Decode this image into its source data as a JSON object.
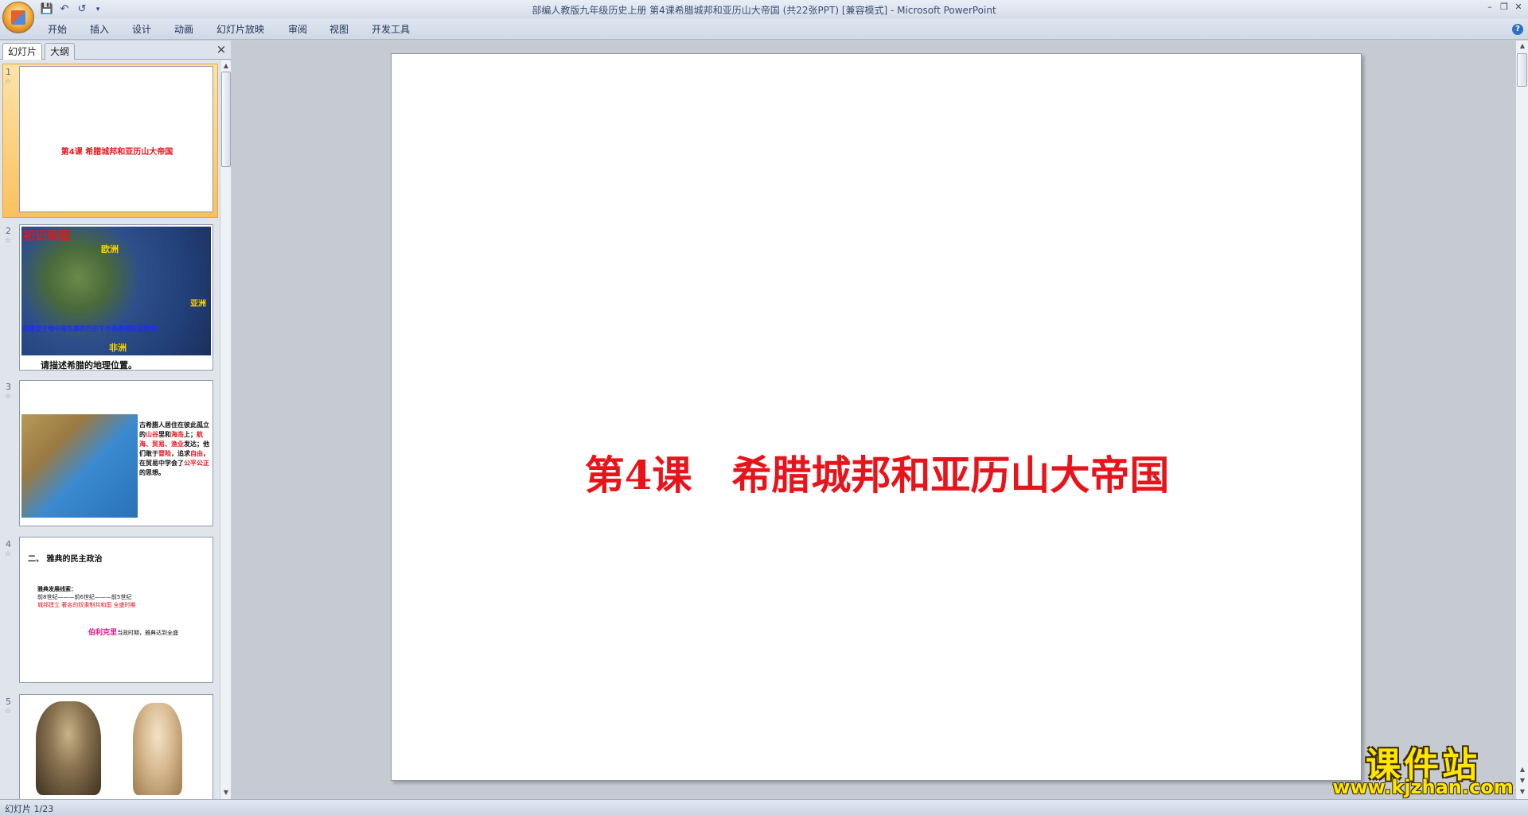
{
  "window": {
    "title": "部编人教版九年级历史上册 第4课希腊城邦和亚历山大帝国 (共22张PPT) [兼容模式] - Microsoft PowerPoint"
  },
  "quick_access": {
    "icons": [
      "save-icon",
      "undo-icon",
      "redo-icon",
      "customize-icon"
    ]
  },
  "ribbon": {
    "tabs": [
      "开始",
      "插入",
      "设计",
      "动画",
      "幻灯片放映",
      "审阅",
      "视图",
      "开发工具"
    ]
  },
  "pane": {
    "tab_slides": "幻灯片",
    "tab_outline": "大纲",
    "close_label": "×"
  },
  "thumbnails": [
    {
      "num": "1",
      "title": "第4课   希腊城邦和亚历山大帝国"
    },
    {
      "num": "2",
      "heading": "初识希腊",
      "map_labels": [
        "欧洲",
        "亚洲",
        "非洲"
      ],
      "caption": "希腊位于地中海东部的巴尔干半岛南部和爱琴海。",
      "question": "请描述希腊的地理位置。"
    },
    {
      "num": "3",
      "text_black_1": "古希腊人居住在彼此孤立的",
      "text_red_1": "山谷",
      "text_black_2": "里和",
      "text_red_2": "海岛",
      "text_black_3": "上；",
      "text_red_3": "航海、贸易、渔业",
      "text_black_4": "发达；他们敢于",
      "text_red_4": "冒险",
      "text_black_5": "，追求",
      "text_red_5": "自由",
      "text_black_6": "，在贸易中学会了",
      "text_red_6": "公平公正",
      "text_black_7": "的思想。"
    },
    {
      "num": "4",
      "heading": "二、 雅典的民主政治",
      "line1": "雅典发展线索：",
      "line2": "前8世纪———前6世纪———前5世纪",
      "line3": "城邦建立      著名的奴隶制共和国      全盛时期",
      "name_red": "伯利克里",
      "line4": "当政时期，雅典达到全盛"
    },
    {
      "num": "5"
    }
  ],
  "slide": {
    "title": "第4课　希腊城邦和亚历山大帝国"
  },
  "status": {
    "slide_info": "幻灯片 1/23"
  },
  "watermark": {
    "cn": "课件站",
    "url": "www.kjzhan.com"
  }
}
